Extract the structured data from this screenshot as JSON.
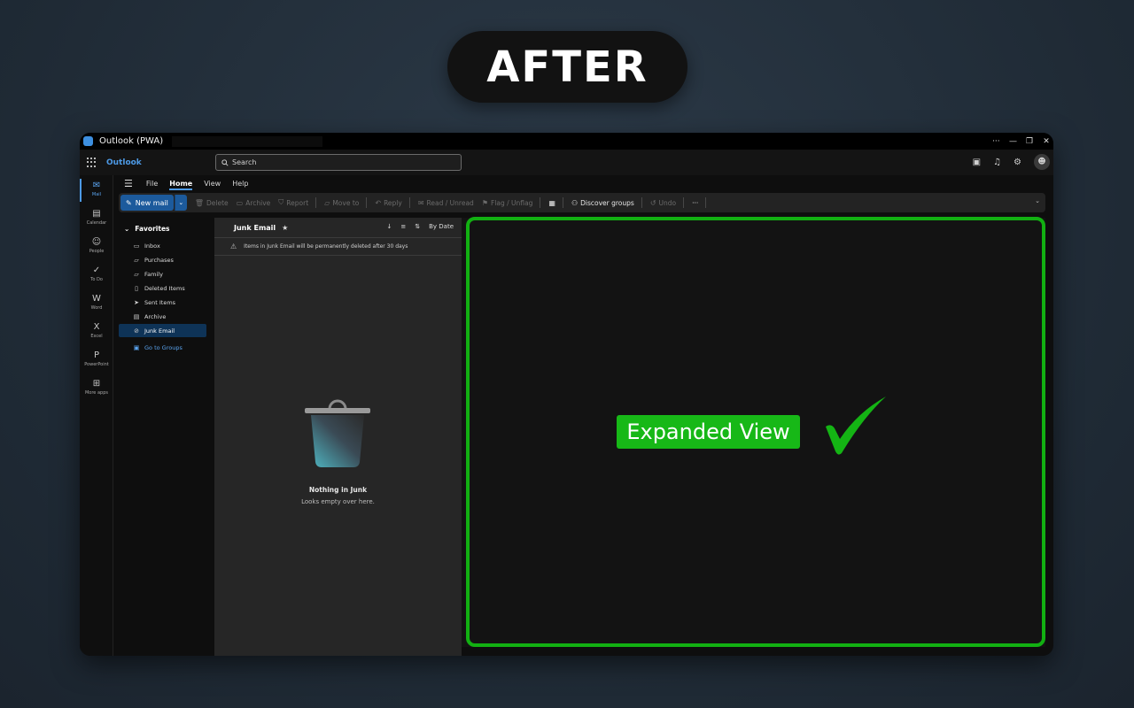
{
  "banner": {
    "label": "AFTER"
  },
  "window": {
    "title": "Outlook (PWA)",
    "controls": [
      "···",
      "—",
      "❐",
      "✕"
    ]
  },
  "topbar": {
    "brand": "Outlook",
    "search_placeholder": "Search",
    "icons": [
      "note-icon",
      "bell-icon",
      "gear-icon",
      "avatar"
    ]
  },
  "rail": {
    "items": [
      {
        "label": "Mail",
        "icon": "mail-icon",
        "glyph": "✉",
        "active": true
      },
      {
        "label": "Calendar",
        "icon": "calendar-icon",
        "glyph": "▤"
      },
      {
        "label": "People",
        "icon": "people-icon",
        "glyph": "☺"
      },
      {
        "label": "To Do",
        "icon": "check-icon",
        "glyph": "✓"
      },
      {
        "label": "Word",
        "icon": "word-icon",
        "glyph": "W"
      },
      {
        "label": "Excel",
        "icon": "excel-icon",
        "glyph": "X"
      },
      {
        "label": "PowerPoint",
        "icon": "powerpoint-icon",
        "glyph": "P"
      },
      {
        "label": "More apps",
        "icon": "apps-icon",
        "glyph": "⊞"
      }
    ]
  },
  "ribbon": {
    "tabs": [
      "File",
      "Home",
      "View",
      "Help"
    ],
    "active_tab": "Home"
  },
  "toolbar": {
    "new_mail": "New mail",
    "delete": "Delete",
    "archive": "Archive",
    "report": "Report",
    "move_to": "Move to",
    "reply": "Reply",
    "read_unread": "Read / Unread",
    "flag_unflag": "Flag / Unflag",
    "discover_groups": "Discover groups",
    "undo": "Undo",
    "more": "···"
  },
  "folders": {
    "header": "Favorites",
    "items": [
      {
        "label": "Inbox",
        "icon": "inbox-icon"
      },
      {
        "label": "Purchases",
        "icon": "folder-icon"
      },
      {
        "label": "Family",
        "icon": "folder-icon"
      },
      {
        "label": "Deleted Items",
        "icon": "trash-icon"
      },
      {
        "label": "Sent Items",
        "icon": "send-icon"
      },
      {
        "label": "Archive",
        "icon": "archive-icon"
      },
      {
        "label": "Junk Email",
        "icon": "junk-icon",
        "active": true
      }
    ],
    "groups_link": "Go to Groups"
  },
  "message_list": {
    "title": "Junk Email",
    "sort_label": "By Date",
    "notice": "Items in Junk Email will be permanently deleted after 30 days",
    "empty_title": "Nothing in Junk",
    "empty_subtitle": "Looks empty over here."
  },
  "reading_pane": {
    "label": "Expanded View",
    "highlight_color": "#12b012"
  },
  "colors": {
    "accent": "#4d9ae6",
    "new_mail_bg": "#1c5a9c",
    "highlight": "#17b817"
  }
}
